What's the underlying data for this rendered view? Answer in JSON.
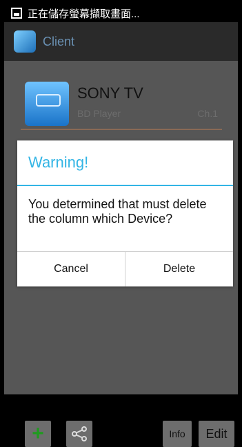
{
  "status_bar": {
    "text": "正在儲存螢幕擷取畫面..."
  },
  "action_bar": {
    "title": "Client"
  },
  "device": {
    "name": "SONY TV",
    "type": "BD Player",
    "channel": "Ch.1"
  },
  "dialog": {
    "title": "Warning!",
    "message": "You determined that must delete the column which Device?",
    "cancel_label": "Cancel",
    "delete_label": "Delete"
  },
  "toolbar": {
    "info_label": "Info",
    "edit_label": "Edit"
  },
  "colors": {
    "accent": "#33b5e5",
    "add_icon": "#1f9b1f"
  }
}
